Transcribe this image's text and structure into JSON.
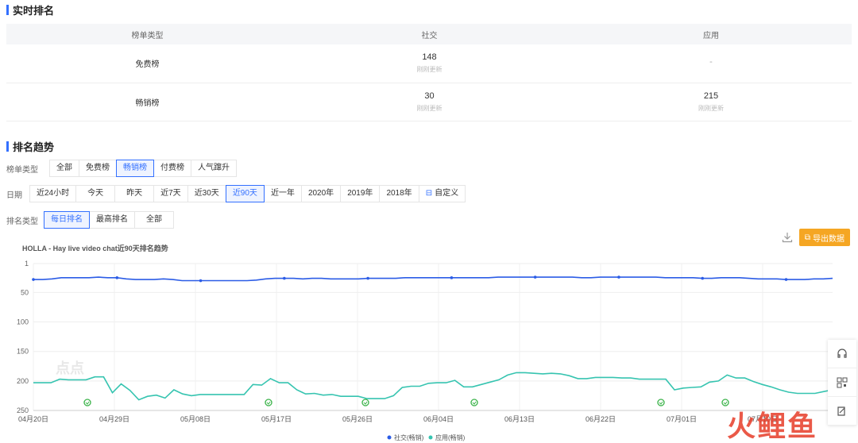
{
  "realtime": {
    "title": "实时排名",
    "headers": [
      "榜单类型",
      "社交",
      "应用"
    ],
    "rows": [
      {
        "type": "免费榜",
        "social": "148",
        "social_sub": "刚刚更新",
        "app": "-",
        "app_sub": ""
      },
      {
        "type": "畅销榜",
        "social": "30",
        "social_sub": "刚刚更新",
        "app": "215",
        "app_sub": "刚刚更新"
      }
    ]
  },
  "trend": {
    "title": "排名趋势",
    "list_type": {
      "label": "榜单类型",
      "options": [
        "全部",
        "免费榜",
        "畅销榜",
        "付费榜",
        "人气蹿升"
      ],
      "active": 2
    },
    "date": {
      "label": "日期",
      "options": [
        "近24小时",
        "今天",
        "昨天",
        "近7天",
        "近30天",
        "近90天",
        "近一年",
        "2020年",
        "2019年",
        "2018年",
        "自定义"
      ],
      "active": 5
    },
    "rank_type": {
      "label": "排名类型",
      "options": [
        "每日排名",
        "最高排名",
        "全部"
      ],
      "active": 0
    }
  },
  "export_label": "导出数据",
  "watermark_logo": "点点",
  "corner_logo": "火鲤鱼",
  "chart_data": {
    "type": "line",
    "title": "HOLLA - Hay live video chat近90天排名趋势",
    "y_reversed": true,
    "ylim": [
      1,
      250
    ],
    "yticks": [
      1,
      50,
      100,
      150,
      200,
      250
    ],
    "xtick_labels": [
      "04月20日",
      "04月29日",
      "05月08日",
      "05月17日",
      "05月26日",
      "06月04日",
      "06月13日",
      "06月22日",
      "07月01日",
      "07月10日",
      "07月19日"
    ],
    "legend": [
      "社交(畅销)",
      "应用(畅销)"
    ],
    "colors": [
      "#2b5ce6",
      "#36c4b0"
    ],
    "series": [
      {
        "name": "社交(畅销)",
        "values": [
          28,
          28,
          27,
          25,
          25,
          25,
          25,
          24,
          25,
          25,
          27,
          28,
          28,
          28,
          27,
          28,
          30,
          30,
          30,
          30,
          30,
          30,
          30,
          30,
          29,
          27,
          26,
          26,
          26,
          27,
          26,
          26,
          27,
          27,
          27,
          27,
          26,
          26,
          26,
          26,
          25,
          25,
          25,
          25,
          25,
          25,
          25,
          25,
          25,
          25,
          24,
          24,
          24,
          24,
          24,
          24,
          24,
          24,
          24,
          25,
          25,
          24,
          24,
          24,
          24,
          24,
          24,
          24,
          25,
          25,
          25,
          25,
          26,
          26,
          25,
          25,
          25,
          26,
          27,
          27,
          27,
          28,
          28,
          28,
          27,
          27,
          26
        ]
      },
      {
        "name": "应用(畅销)",
        "values": [
          203,
          203,
          203,
          197,
          198,
          198,
          198,
          193,
          193,
          220,
          205,
          216,
          232,
          226,
          224,
          229,
          215,
          222,
          225,
          223,
          223,
          223,
          223,
          223,
          223,
          206,
          207,
          196,
          203,
          203,
          215,
          222,
          221,
          224,
          223,
          226,
          226,
          226,
          230,
          230,
          230,
          225,
          211,
          209,
          209,
          204,
          203,
          203,
          199,
          210,
          210,
          206,
          202,
          198,
          190,
          186,
          186,
          187,
          188,
          187,
          188,
          191,
          196,
          196,
          194,
          194,
          194,
          195,
          195,
          197,
          197,
          197,
          197,
          215,
          212,
          211,
          210,
          202,
          200,
          190,
          195,
          195,
          201,
          206,
          210,
          215,
          219,
          221,
          221,
          221,
          218,
          215
        ]
      }
    ]
  }
}
